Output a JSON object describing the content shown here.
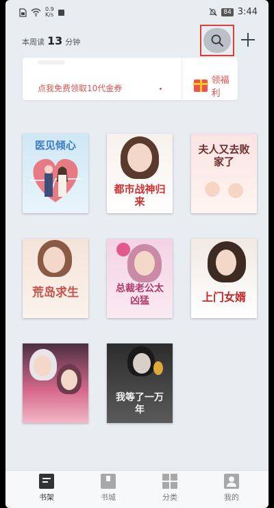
{
  "status_bar": {
    "net_speed_value": "0.9",
    "net_speed_unit": "K/s",
    "battery": "84",
    "time": "3:44"
  },
  "header": {
    "reading_label_prefix": "本周读",
    "reading_minutes": "13",
    "reading_label_suffix": "分钟",
    "search_icon": "search-icon",
    "add_icon": "plus-icon"
  },
  "banner": {
    "promo_text": "点我免费领取10代金券",
    "welfare_label": "领福利",
    "gift_icon": "gift-icon"
  },
  "books": [
    {
      "title": "医见倾心",
      "name": "book-cover-1"
    },
    {
      "title": "都市战神归来",
      "name": "book-cover-2"
    },
    {
      "title": "夫人又去败家了",
      "name": "book-cover-3"
    },
    {
      "title": "荒岛求生",
      "name": "book-cover-4"
    },
    {
      "title": "总裁老公太凶猛",
      "name": "book-cover-5"
    },
    {
      "title": "上门女婿",
      "name": "book-cover-6"
    },
    {
      "title": "",
      "name": "book-cover-7"
    },
    {
      "title": "我等了一万年",
      "name": "book-cover-8"
    }
  ],
  "tabs": [
    {
      "label": "书架",
      "icon": "bookshelf-icon",
      "active": true
    },
    {
      "label": "书城",
      "icon": "bookstore-icon",
      "active": false
    },
    {
      "label": "分类",
      "icon": "category-grid-icon",
      "active": false
    },
    {
      "label": "我的",
      "icon": "profile-icon",
      "active": false
    }
  ],
  "colors": {
    "background": "#e8edf2",
    "highlight_border": "#e53935",
    "promo_red": "#d9534f"
  }
}
